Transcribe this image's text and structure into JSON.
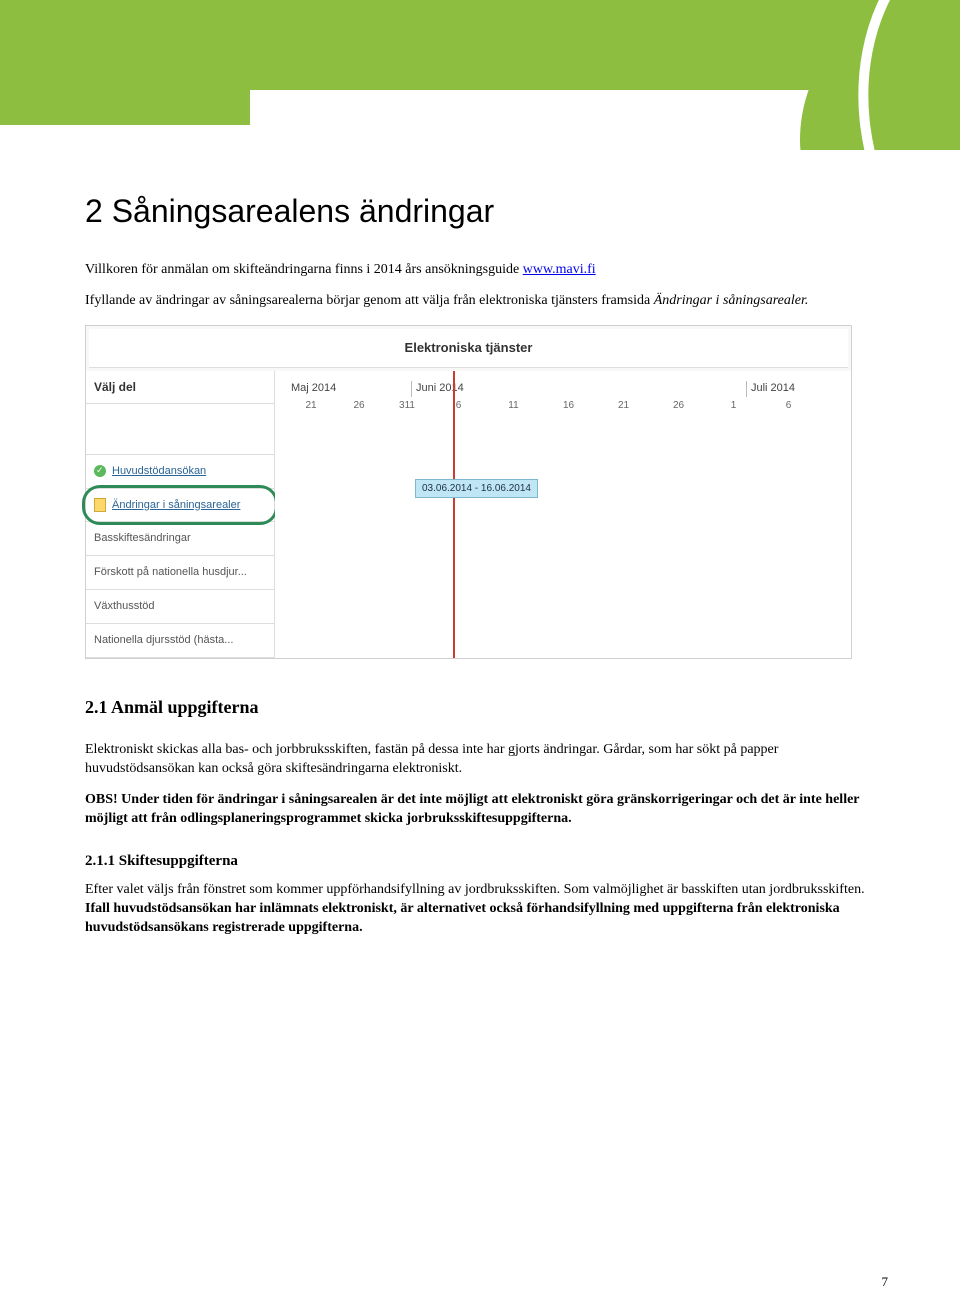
{
  "header": {},
  "doc": {
    "h1": "2 Såningsarealens ändringar",
    "p1_pre": "Villkoren för anmälan om skifteändringarna finns i 2014 års ansökningsguide ",
    "p1_link": "www.mavi.fi",
    "p2_pre": "Ifyllande av ändringar av såningsarealerna börjar genom att välja från elektroniska tjänsters framsida ",
    "p2_ital": "Ändringar i såningsarealer.",
    "h2": "2.1 Anmäl uppgifterna",
    "p3": "Elektroniskt skickas alla bas- och jorbbruksskiften, fastän på dessa inte har gjorts ändringar. Gårdar, som har sökt på papper huvudstödsansökan kan också göra skiftesändringarna elektroniskt.",
    "p4": "OBS! Under tiden för ändringar i såningsarealen är det inte möjligt att elektroniskt göra gränskorrigeringar och det är inte heller möjligt att från odlingsplaneringsprogrammet skicka jorbruksskiftesuppgifterna.",
    "h3": "2.1.1 Skiftesuppgifterna",
    "p5_plain": "Efter valet väljs från fönstret som kommer uppförhandsifyllning av jordbruksskiften. Som valmöjlighet är basskiften utan jordbruksskiften. ",
    "p5_bold": "Ifall huvudstödsansökan har inlämnats elektroniskt, är alternativet också förhandsifyllning med uppgifterna från elektroniska huvudstödsansökans registrerade uppgifterna.",
    "page_num": "7"
  },
  "screenshot": {
    "title": "Elektroniska tjänster",
    "left_head": "Välj del",
    "rows": [
      {
        "icon": "check",
        "label": "Huvudstödansökan",
        "link": true
      },
      {
        "icon": "doc",
        "label": "Ändringar i såningsarealer",
        "link": true,
        "selected": true
      },
      {
        "icon": "",
        "label": "Basskiftesändringar",
        "link": false
      },
      {
        "icon": "",
        "label": "Förskott på nationella husdjur...",
        "link": false
      },
      {
        "icon": "",
        "label": "Växthusstöd",
        "link": false
      },
      {
        "icon": "",
        "label": "Nationella djursstöd (hästa...",
        "link": false
      }
    ],
    "months": [
      "Maj 2014",
      "Juni 2014",
      "Juli 2014"
    ],
    "days": [
      "21",
      "26",
      "311",
      "6",
      "11",
      "16",
      "21",
      "26",
      "1",
      "6"
    ],
    "chip": "03.06.2014 - 16.06.2014"
  }
}
